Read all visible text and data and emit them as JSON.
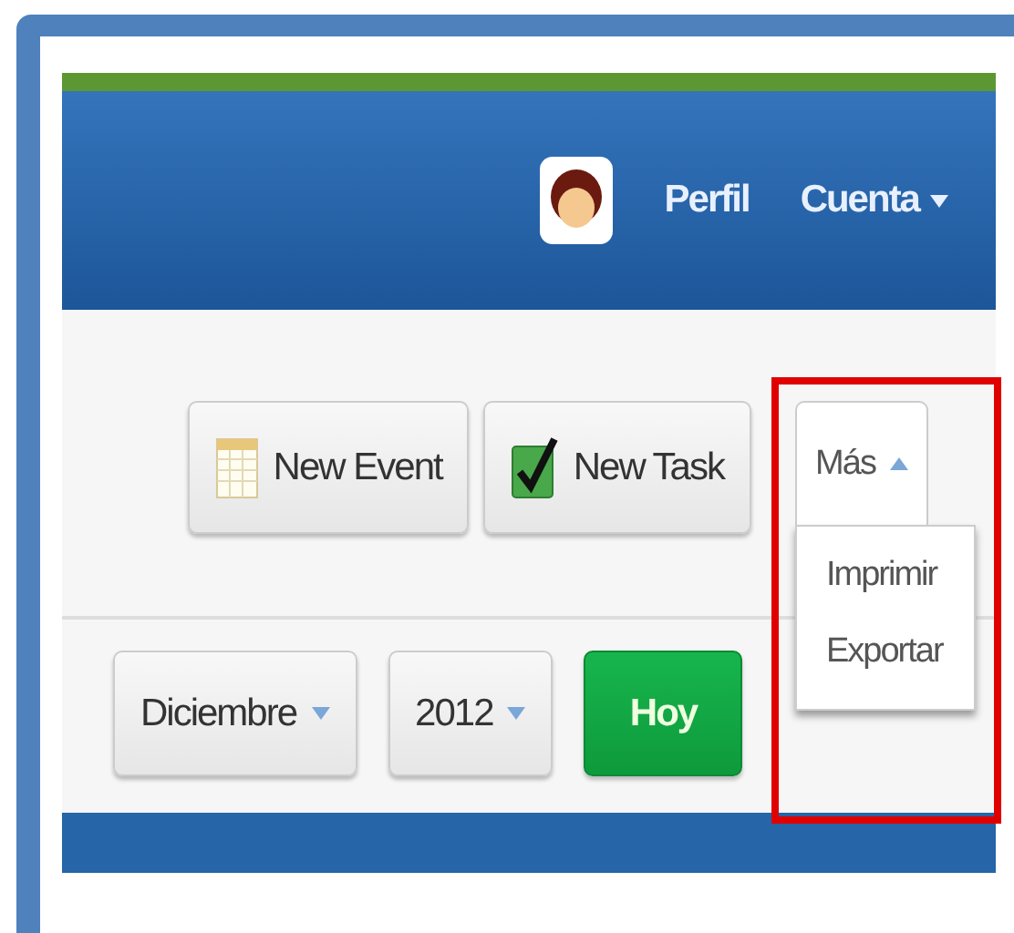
{
  "header": {
    "profile": "Perfil",
    "account": "Cuenta"
  },
  "toolbar": {
    "buttons": [
      {
        "kind": "event",
        "label": "New Event"
      },
      {
        "kind": "task",
        "label": "New Task"
      }
    ],
    "more": {
      "label": "Más",
      "expanded": true,
      "highlighted": true,
      "items": [
        "Imprimir",
        "Exportar"
      ]
    }
  },
  "nav": {
    "month": "Diciembre",
    "year": "2012",
    "today": "Hoy"
  }
}
